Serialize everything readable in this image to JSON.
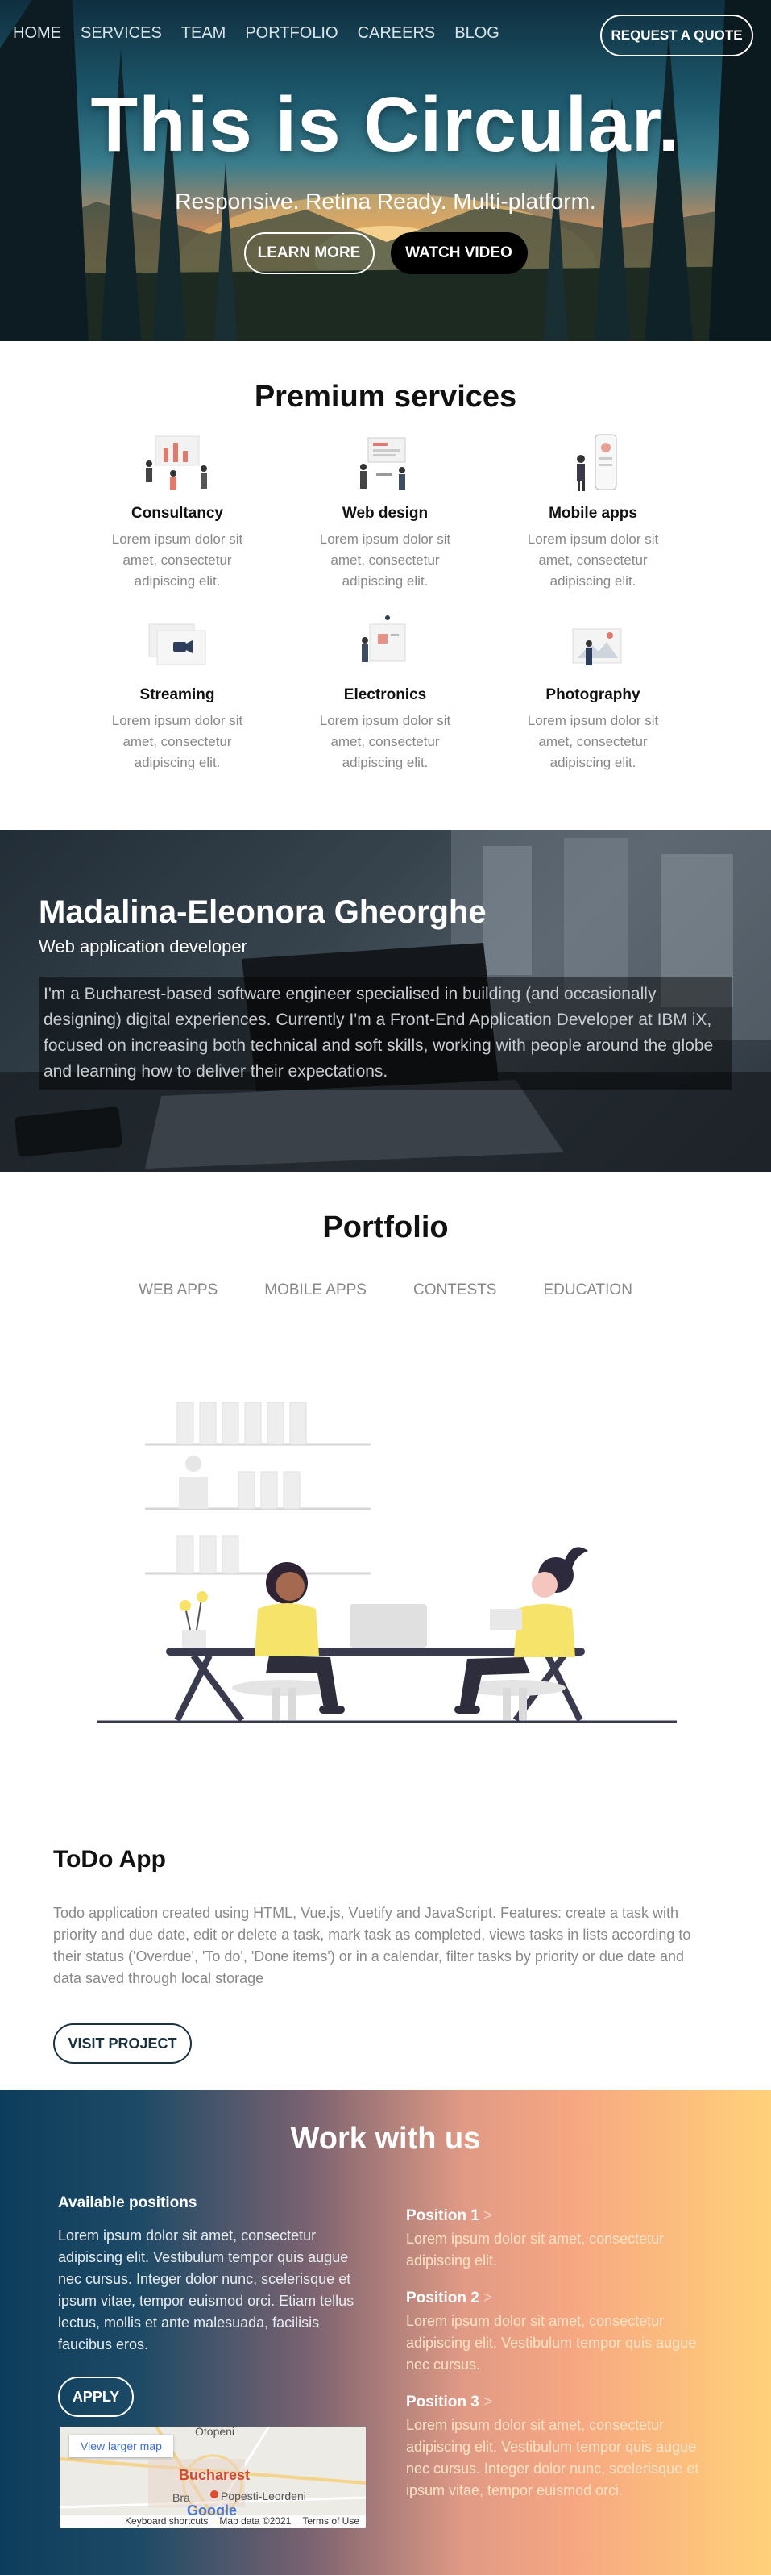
{
  "nav": {
    "links": [
      "HOME",
      "SERVICES",
      "TEAM",
      "PORTFOLIO",
      "CAREERS",
      "BLOG"
    ],
    "cta": "REQUEST A QUOTE"
  },
  "hero": {
    "title": "This is Circular.",
    "subtitle": "Responsive. Retina Ready. Multi-platform.",
    "learn_more": "LEARN MORE",
    "watch_video": "WATCH VIDEO"
  },
  "services": {
    "title": "Premium services",
    "items": [
      {
        "title": "Consultancy",
        "desc": "Lorem ipsum dolor sit amet, consectetur adipiscing elit.",
        "icon": "team-presentation-illustration"
      },
      {
        "title": "Web design",
        "desc": "Lorem ipsum dolor sit amet, consectetur adipiscing elit.",
        "icon": "web-design-illustration"
      },
      {
        "title": "Mobile apps",
        "desc": "Lorem ipsum dolor sit amet, consectetur adipiscing elit.",
        "icon": "mobile-app-illustration"
      },
      {
        "title": "Streaming",
        "desc": "Lorem ipsum dolor sit amet, consectetur adipiscing elit.",
        "icon": "video-streaming-illustration"
      },
      {
        "title": "Electronics",
        "desc": "Lorem ipsum dolor sit amet, consectetur adipiscing elit.",
        "icon": "electronics-illustration"
      },
      {
        "title": "Photography",
        "desc": "Lorem ipsum dolor sit amet, consectetur adipiscing elit.",
        "icon": "photography-illustration"
      }
    ]
  },
  "profile": {
    "name": "Madalina-Eleonora Gheorghe",
    "role": "Web application developer",
    "bio": "I'm a Bucharest-based software engineer specialised in building (and occasionally designing) digital experiences. Currently I'm a Front-End Application Developer at IBM iX, focused on increasing both technical and soft skills, working with people around the globe and learning how to deliver their expectations."
  },
  "portfolio": {
    "title": "Portfolio",
    "tabs": [
      "WEB APPS",
      "MOBILE APPS",
      "CONTESTS",
      "EDUCATION"
    ],
    "project_title": "ToDo App",
    "project_desc": "Todo application created using HTML, Vue.js, Vuetify and JavaScript. Features: create a task with priority and due date, edit or delete a task, mark task as completed, views tasks in lists according to their status ('Overdue', 'To do', 'Done items') or in a calendar, filter tasks by priority or due date and data saved through local storage",
    "visit": "VISIT PROJECT"
  },
  "work": {
    "title": "Work with us",
    "available": "Available positions",
    "text": "Lorem ipsum dolor sit amet, consectetur adipiscing elit. Vestibulum tempor quis augue nec cursus. Integer dolor nunc, scelerisque et ipsum vitae, tempor euismod orci. Etiam tellus lectus, mollis et ante malesuada, facilisis faucibus eros.",
    "apply": "APPLY",
    "map": {
      "link": "View larger map",
      "city": "Bucharest",
      "label_north": "Otopeni",
      "label_south": "Popesti-Leordeni",
      "label_west": "Bra",
      "footer": [
        "Keyboard shortcuts",
        "Map data ©2021",
        "Terms of Use"
      ],
      "brand": "Google"
    },
    "positions": [
      {
        "title": "Position 1",
        "desc": "Lorem ipsum dolor sit amet, consectetur adipiscing elit."
      },
      {
        "title": "Position 2",
        "desc": "Lorem ipsum dolor sit amet, consectetur adipiscing elit. Vestibulum tempor quis augue nec cursus."
      },
      {
        "title": "Position 3",
        "desc": "Lorem ipsum dolor sit amet, consectetur adipiscing elit. Vestibulum tempor quis augue nec cursus. Integer dolor nunc, scelerisque et ipsum vitae, tempor euismod orci."
      }
    ]
  }
}
